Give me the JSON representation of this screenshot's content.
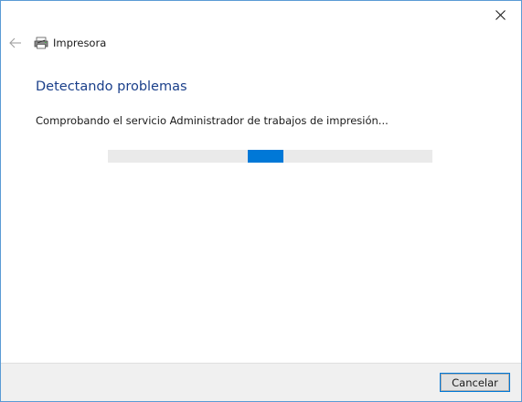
{
  "window": {
    "title": "Impresora",
    "accent_color": "#0078d7"
  },
  "main": {
    "heading": "Detectando problemas",
    "status": "Comprobando el servicio Administrador de trabajos de impresión...",
    "progress": {
      "indeterminate": true
    }
  },
  "footer": {
    "cancel_label": "Cancelar"
  },
  "icons": {
    "close": "close-icon",
    "back": "back-arrow-icon",
    "app": "printer-icon"
  }
}
